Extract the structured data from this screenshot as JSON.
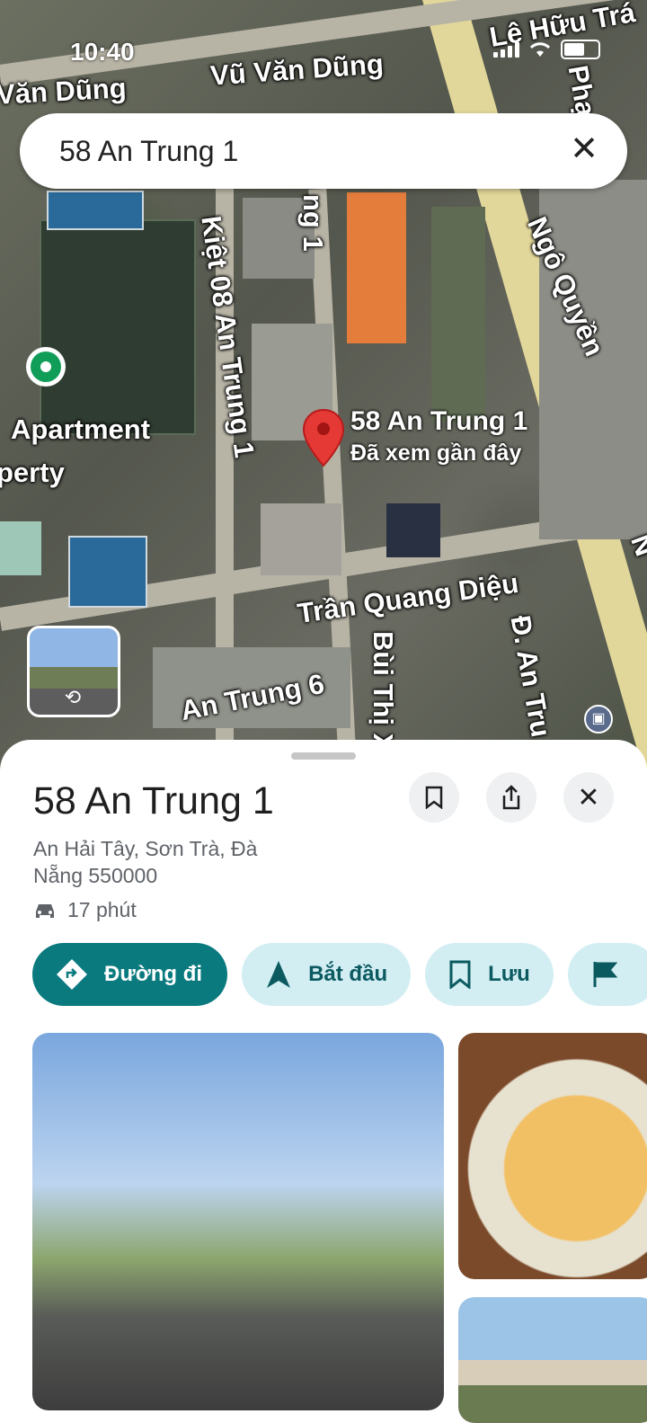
{
  "status_bar": {
    "time": "10:40"
  },
  "search": {
    "query": "58 An Trung 1"
  },
  "map": {
    "streets": [
      "Văn Dũng",
      "Vũ Văn Dũng",
      "Lê Hữu Trá",
      "Phạm",
      "ng 1",
      "Kiệt 08 An Trung 1",
      "Ngô Quyền",
      "Trần Quang Diệu",
      "An Trung 6",
      "Bùi Thị X",
      "Đ. An Tru",
      "N"
    ],
    "poi": [
      "Apartment",
      "perty"
    ],
    "pin": {
      "title": "58 An Trung 1",
      "subtitle": "Đã xem gần đây"
    }
  },
  "sheet": {
    "title": "58 An Trung 1",
    "address": "An Hải Tây, Sơn Trà, Đà Nẵng 550000",
    "drive_time": "17 phút",
    "actions": [
      "Đường đi",
      "Bắt đầu",
      "Lưu",
      ""
    ]
  },
  "icons": {
    "bookmark": "bookmark-icon",
    "share": "share-icon",
    "close": "close-icon",
    "car": "car-icon",
    "directions": "directions-icon",
    "navigation": "navigation-arrow-icon",
    "flag": "flag-icon"
  },
  "colors": {
    "primary": "#0b7a7f",
    "chip_bg": "#d2eef3",
    "pin": "#e53935",
    "poi_green": "#0f9d58"
  }
}
